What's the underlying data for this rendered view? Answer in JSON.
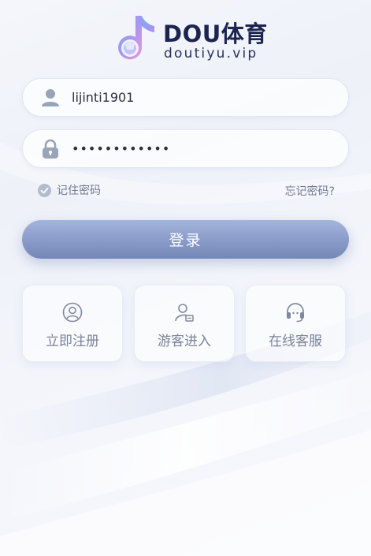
{
  "logo": {
    "title": "DOU体育",
    "subtitle": "doutiyu.vip"
  },
  "login_form": {
    "username_value": "lijinti1901",
    "password_value": "••••••••••••",
    "remember_label": "记住密码",
    "forgot_label": "忘记密码?",
    "submit_label": "登录"
  },
  "actions": [
    {
      "label": "立即注册",
      "icon": "user-circle-icon"
    },
    {
      "label": "游客进入",
      "icon": "guest-user-icon"
    },
    {
      "label": "在线客服",
      "icon": "headset-icon"
    }
  ],
  "colors": {
    "primary_button": "#8d9fcb",
    "title_text": "#1c2550",
    "muted_text": "#7a8397"
  }
}
